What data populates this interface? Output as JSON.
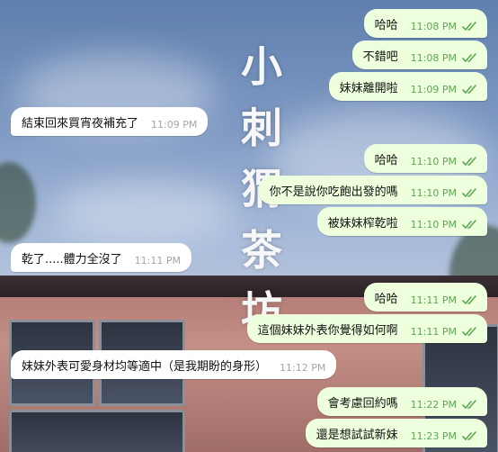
{
  "background": {
    "sign_chars": [
      "小",
      "刺",
      "猬",
      "茶",
      "坊"
    ]
  },
  "colors": {
    "outgoing_bubble": "#eeffde",
    "incoming_bubble": "#ffffff",
    "outgoing_time": "#5fa656",
    "incoming_time": "#a0a6ab"
  },
  "messages": [
    {
      "dir": "out",
      "text": "哈哈",
      "time": "11:08 PM",
      "status": "read"
    },
    {
      "dir": "out",
      "text": "不錯吧",
      "time": "11:08 PM",
      "status": "read"
    },
    {
      "dir": "out",
      "text": "妹妹離開啦",
      "time": "11:09 PM",
      "status": "read"
    },
    {
      "dir": "in",
      "text": "結束回來買宵夜補充了",
      "time": "11:09 PM"
    },
    {
      "dir": "out",
      "text": "哈哈",
      "time": "11:10 PM",
      "status": "read"
    },
    {
      "dir": "out",
      "text": "你不是說你吃飽出發的嗎",
      "time": "11:10 PM",
      "status": "read"
    },
    {
      "dir": "out",
      "text": "被妹妹榨乾啦",
      "time": "11:10 PM",
      "status": "read"
    },
    {
      "dir": "in",
      "text": "乾了.....體力全沒了",
      "time": "11:11 PM"
    },
    {
      "dir": "out",
      "text": "哈哈",
      "time": "11:11 PM",
      "status": "read"
    },
    {
      "dir": "out",
      "text": "這個妹妹外表你覺得如何啊",
      "time": "11:11 PM",
      "status": "read"
    },
    {
      "dir": "in",
      "text": "妹妹外表可愛身材均等適中（是我期盼的身形）",
      "time": "11:12 PM"
    },
    {
      "dir": "out",
      "text": "會考慮回約嗎",
      "time": "11:22 PM",
      "status": "read"
    },
    {
      "dir": "out",
      "text": "還是想試試新妹",
      "time": "11:23 PM",
      "status": "read"
    }
  ]
}
